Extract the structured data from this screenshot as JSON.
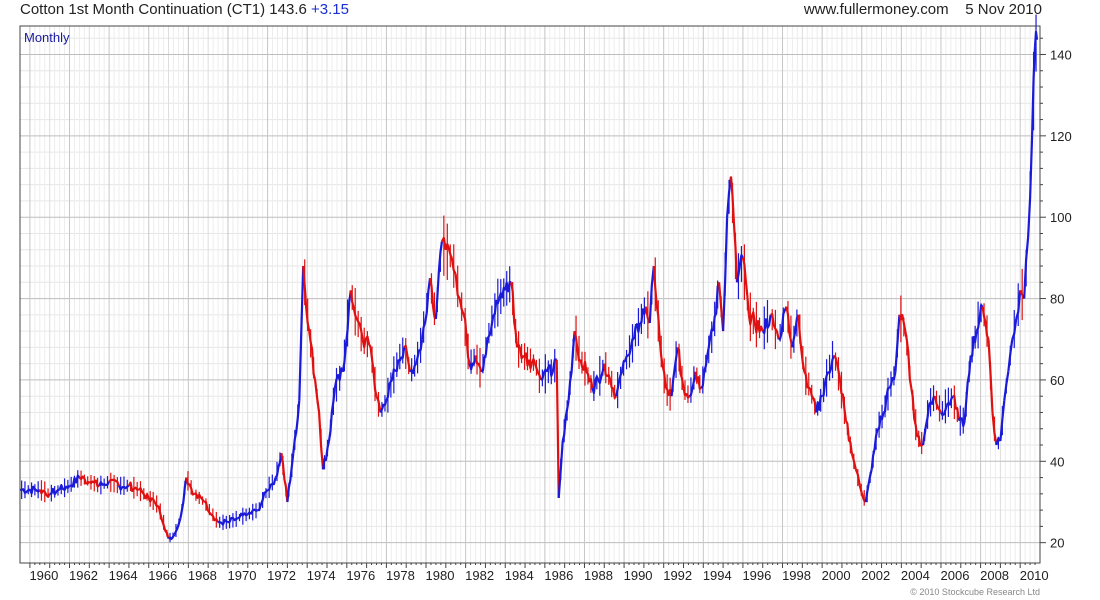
{
  "header": {
    "instrument": "Cotton 1st Month Continuation (CT1)",
    "last": "143.6",
    "change": "+3.15",
    "site": "www.fullermoney.com",
    "date": "5 Nov 2010"
  },
  "copyright": "© 2010 Stockcube Research Ltd",
  "colors": {
    "up": "#1a1ad8",
    "down": "#e01010",
    "grid": "#d8d8d8",
    "frame": "#444444",
    "label": "#1a1aa0"
  },
  "chart_data": {
    "type": "line",
    "period_label": "Monthly",
    "xlabel": "",
    "ylabel": "",
    "xlim": [
      1959.5,
      2011.0
    ],
    "ylim": [
      15,
      147
    ],
    "x_ticks": [
      "1960",
      "1962",
      "1964",
      "1966",
      "1968",
      "1970",
      "1972",
      "1974",
      "1976",
      "1978",
      "1980",
      "1982",
      "1984",
      "1986",
      "1988",
      "1990",
      "1992",
      "1994",
      "1996",
      "1998",
      "2000",
      "2002",
      "2004",
      "2006",
      "2008",
      "2010"
    ],
    "y_ticks": [
      20,
      40,
      60,
      80,
      100,
      120,
      140
    ],
    "series": [
      {
        "x": [
          1959.5,
          1960.5,
          1961.0,
          1961.5,
          1962.0,
          1962.5,
          1963.0,
          1963.5,
          1964.0,
          1964.5,
          1965.0,
          1965.5,
          1966.0,
          1966.3,
          1966.5,
          1967.0,
          1967.3,
          1967.6,
          1967.9,
          1968.3,
          1968.8,
          1969.5,
          1970.0,
          1970.5,
          1971.0,
          1971.5,
          1972.0,
          1972.4,
          1972.7,
          1973.0,
          1973.3,
          1973.6,
          1973.8,
          1974.1,
          1974.4,
          1974.6,
          1974.8,
          1975.1,
          1975.4,
          1975.8,
          1976.2,
          1976.5,
          1976.8,
          1977.2,
          1977.5,
          1977.7,
          1978.0,
          1978.3,
          1978.6,
          1978.9,
          1979.2,
          1979.5,
          1979.8,
          1980.2,
          1980.5,
          1980.8,
          1981.0,
          1981.3,
          1981.5,
          1981.7,
          1981.9,
          1982.2,
          1982.5,
          1982.8,
          1983.1,
          1983.4,
          1983.7,
          1984.0,
          1984.3,
          1984.6,
          1984.9,
          1985.2,
          1985.5,
          1985.8,
          1986.1,
          1986.4,
          1986.6,
          1986.7,
          1986.9,
          1987.2,
          1987.5,
          1987.8,
          1988.1,
          1988.4,
          1988.7,
          1989.0,
          1989.3,
          1989.6,
          1989.9,
          1990.2,
          1990.5,
          1990.8,
          1991.1,
          1991.3,
          1991.5,
          1991.8,
          1992.1,
          1992.4,
          1992.7,
          1993.0,
          1993.3,
          1993.6,
          1993.9,
          1994.2,
          1994.5,
          1994.8,
          1995.0,
          1995.2,
          1995.4,
          1995.7,
          1996.0,
          1996.3,
          1996.6,
          1997.0,
          1997.4,
          1997.8,
          1998.2,
          1998.5,
          1998.8,
          1999.1,
          1999.4,
          1999.7,
          2000.0,
          2000.3,
          2000.6,
          2000.9,
          2001.2,
          2001.5,
          2001.7,
          2001.9,
          2002.2,
          2002.5,
          2002.8,
          2003.1,
          2003.4,
          2003.7,
          2003.9,
          2004.2,
          2004.5,
          2004.8,
          2005.1,
          2005.4,
          2005.7,
          2006.0,
          2006.3,
          2006.6,
          2006.9,
          2007.2,
          2007.5,
          2007.8,
          2008.1,
          2008.4,
          2008.6,
          2008.8,
          2009.0,
          2009.2,
          2009.4,
          2009.6,
          2009.8,
          2010.0,
          2010.2,
          2010.4,
          2010.6,
          2010.75,
          2010.85
        ],
        "y": [
          33,
          33,
          32,
          33,
          34,
          36,
          35,
          34,
          35,
          34,
          34,
          33,
          31,
          30,
          29,
          21,
          22,
          26,
          36,
          32,
          30,
          25,
          25,
          26,
          27,
          28,
          33,
          36,
          42,
          30,
          42,
          55,
          88,
          72,
          60,
          52,
          38,
          45,
          58,
          62,
          82,
          75,
          70,
          68,
          56,
          52,
          55,
          60,
          65,
          68,
          62,
          64,
          70,
          85,
          75,
          94,
          92,
          90,
          86,
          80,
          76,
          64,
          66,
          62,
          70,
          76,
          80,
          82,
          84,
          68,
          66,
          65,
          64,
          60,
          62,
          62,
          65,
          31,
          45,
          55,
          72,
          65,
          62,
          58,
          60,
          64,
          60,
          56,
          62,
          66,
          70,
          74,
          78,
          74,
          88,
          70,
          58,
          56,
          68,
          58,
          56,
          62,
          58,
          66,
          72,
          84,
          72,
          100,
          110,
          84,
          90,
          76,
          74,
          72,
          76,
          70,
          78,
          68,
          76,
          62,
          58,
          52,
          56,
          62,
          66,
          60,
          50,
          42,
          38,
          34,
          30,
          38,
          48,
          52,
          58,
          62,
          76,
          72,
          58,
          46,
          44,
          54,
          56,
          52,
          54,
          56,
          50,
          50,
          66,
          72,
          78,
          70,
          52,
          44,
          45,
          55,
          62,
          70,
          75,
          82,
          80,
          95,
          120,
          142,
          143.6
        ]
      }
    ]
  }
}
